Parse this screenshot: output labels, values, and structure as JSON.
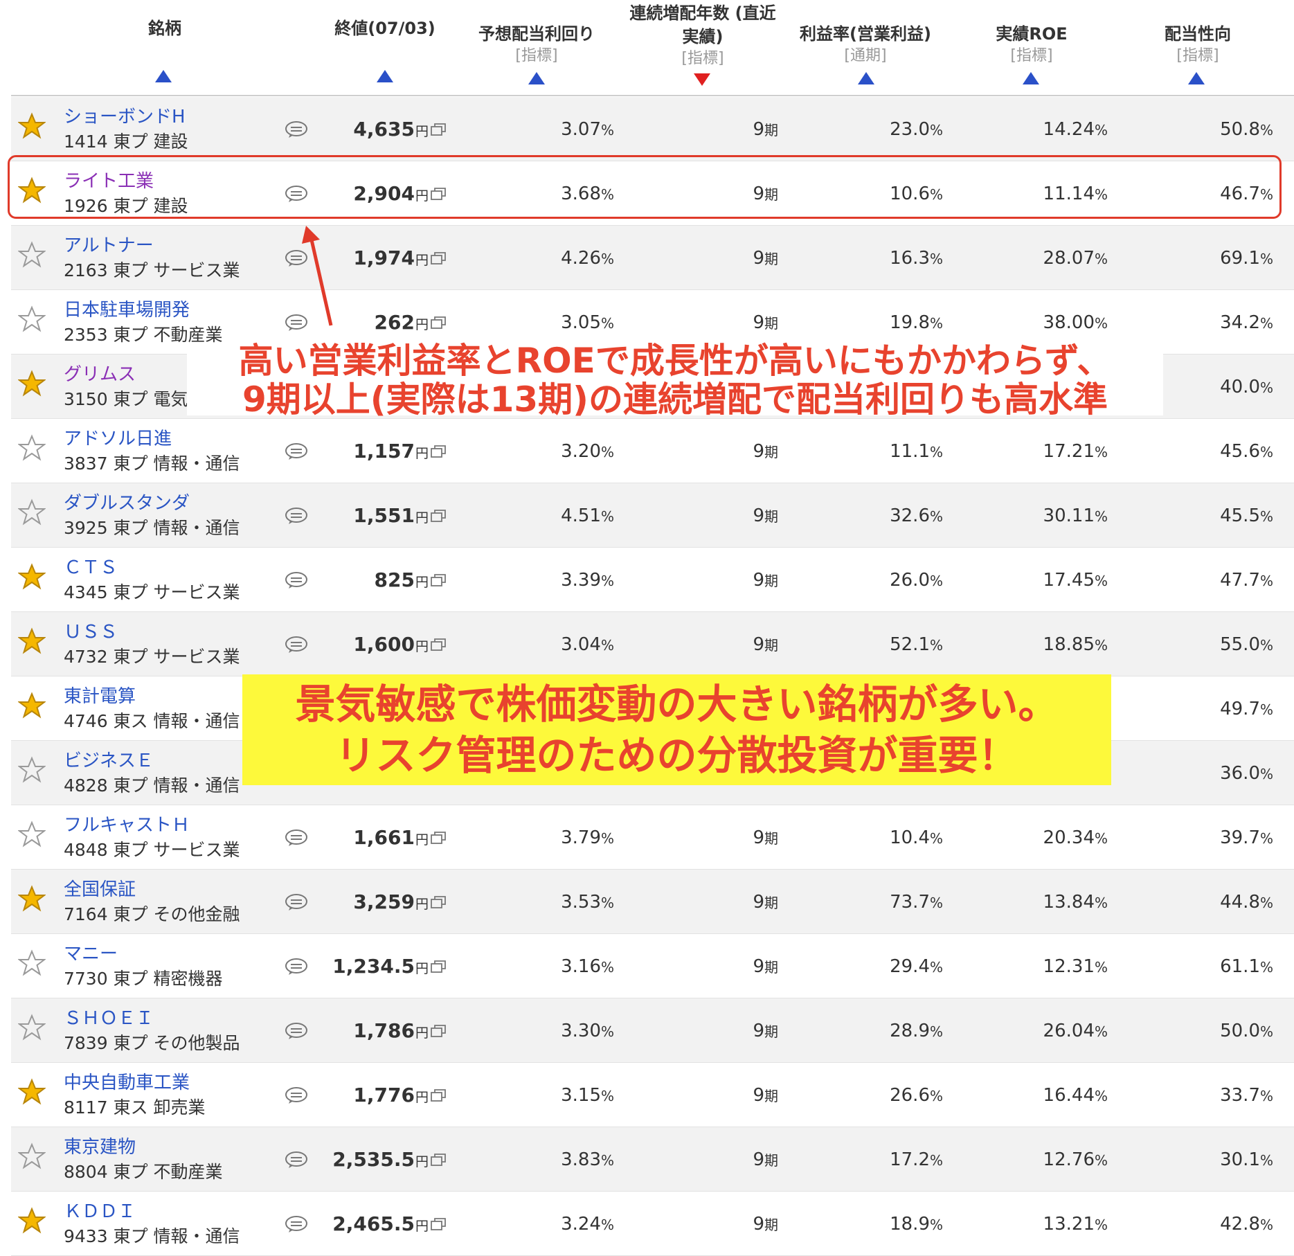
{
  "header": {
    "columns": [
      {
        "label": "銘柄",
        "sub": ""
      },
      {
        "label": "終値(07/03)",
        "sub": ""
      },
      {
        "label": "予想配当利回り",
        "sub": "[指標]"
      },
      {
        "label": "連続増配年数 (直近",
        "label2": "実績)",
        "sub": "[指標]"
      },
      {
        "label": "利益率(営業利益)",
        "sub": "[通期]"
      },
      {
        "label": "実績ROE",
        "sub": "[指標]"
      },
      {
        "label": "配当性向",
        "sub": "[指標]"
      }
    ],
    "sort_directions": [
      "asc",
      "asc",
      "asc",
      "desc",
      "asc",
      "asc",
      "asc"
    ]
  },
  "units": {
    "yen": "円",
    "pct": "%",
    "period": "期"
  },
  "colors": {
    "link_blue": "#2a55c4",
    "link_visited": "#8a2fb5",
    "star_gold": "#f5b700",
    "annotation_red": "#e8432e",
    "highlight_yellow": "#fdf93b",
    "sort_up": "#2a50c8",
    "sort_down": "#e02020"
  },
  "rows": [
    {
      "name": "ショーボンドH",
      "code": "1414",
      "market": "東プ",
      "sector": "建設",
      "favorite": true,
      "visited": false,
      "price": "4,635",
      "yield": "3.07",
      "periods": "9",
      "margin": "23.0",
      "roe": "14.24",
      "payout": "50.8"
    },
    {
      "name": "ライト工業",
      "code": "1926",
      "market": "東プ",
      "sector": "建設",
      "favorite": true,
      "visited": true,
      "price": "2,904",
      "yield": "3.68",
      "periods": "9",
      "margin": "10.6",
      "roe": "11.14",
      "payout": "46.7"
    },
    {
      "name": "アルトナー",
      "code": "2163",
      "market": "東プ",
      "sector": "サービス業",
      "favorite": false,
      "visited": false,
      "price": "1,974",
      "yield": "4.26",
      "periods": "9",
      "margin": "16.3",
      "roe": "28.07",
      "payout": "69.1"
    },
    {
      "name": "日本駐車場開発",
      "code": "2353",
      "market": "東プ",
      "sector": "不動産業",
      "favorite": false,
      "visited": false,
      "price": "262",
      "yield": "3.05",
      "periods": "9",
      "margin": "19.8",
      "roe": "38.00",
      "payout": "34.2"
    },
    {
      "name": "グリムス",
      "code": "3150",
      "market": "東プ",
      "sector": "電気",
      "favorite": true,
      "visited": true,
      "price": "",
      "yield": "",
      "periods": "",
      "margin": "",
      "roe": "",
      "payout": "40.0"
    },
    {
      "name": "アドソル日進",
      "code": "3837",
      "market": "東プ",
      "sector": "情報・通信",
      "favorite": false,
      "visited": false,
      "price": "1,157",
      "yield": "3.20",
      "periods": "9",
      "margin": "11.1",
      "roe": "17.21",
      "payout": "45.6"
    },
    {
      "name": "ダブルスタンダ",
      "code": "3925",
      "market": "東プ",
      "sector": "情報・通信",
      "favorite": false,
      "visited": false,
      "price": "1,551",
      "yield": "4.51",
      "periods": "9",
      "margin": "32.6",
      "roe": "30.11",
      "payout": "45.5"
    },
    {
      "name": "ＣＴＳ",
      "code": "4345",
      "market": "東プ",
      "sector": "サービス業",
      "favorite": true,
      "visited": false,
      "price": "825",
      "yield": "3.39",
      "periods": "9",
      "margin": "26.0",
      "roe": "17.45",
      "payout": "47.7"
    },
    {
      "name": "ＵＳＳ",
      "code": "4732",
      "market": "東プ",
      "sector": "サービス業",
      "favorite": true,
      "visited": false,
      "price": "1,600",
      "yield": "3.04",
      "periods": "9",
      "margin": "52.1",
      "roe": "18.85",
      "payout": "55.0"
    },
    {
      "name": "東計電算",
      "code": "4746",
      "market": "東ス",
      "sector": "情報・通信",
      "favorite": true,
      "visited": false,
      "price": "",
      "yield": "",
      "periods": "",
      "margin": "",
      "roe": "",
      "payout": "49.7"
    },
    {
      "name": "ビジネスＥ",
      "code": "4828",
      "market": "東プ",
      "sector": "情報・通信",
      "favorite": false,
      "visited": false,
      "price": "",
      "yield": "",
      "periods": "",
      "margin": "",
      "roe": "",
      "payout": "36.0"
    },
    {
      "name": "フルキャストＨ",
      "code": "4848",
      "market": "東プ",
      "sector": "サービス業",
      "favorite": false,
      "visited": false,
      "price": "1,661",
      "yield": "3.79",
      "periods": "9",
      "margin": "10.4",
      "roe": "20.34",
      "payout": "39.7"
    },
    {
      "name": "全国保証",
      "code": "7164",
      "market": "東プ",
      "sector": "その他金融",
      "favorite": true,
      "visited": false,
      "price": "3,259",
      "yield": "3.53",
      "periods": "9",
      "margin": "73.7",
      "roe": "13.84",
      "payout": "44.8"
    },
    {
      "name": "マニー",
      "code": "7730",
      "market": "東プ",
      "sector": "精密機器",
      "favorite": false,
      "visited": false,
      "price": "1,234.5",
      "yield": "3.16",
      "periods": "9",
      "margin": "29.4",
      "roe": "12.31",
      "payout": "61.1"
    },
    {
      "name": "ＳＨＯＥＩ",
      "code": "7839",
      "market": "東プ",
      "sector": "その他製品",
      "favorite": false,
      "visited": false,
      "price": "1,786",
      "yield": "3.30",
      "periods": "9",
      "margin": "28.9",
      "roe": "26.04",
      "payout": "50.0"
    },
    {
      "name": "中央自動車工業",
      "code": "8117",
      "market": "東ス",
      "sector": "卸売業",
      "favorite": true,
      "visited": false,
      "price": "1,776",
      "yield": "3.15",
      "periods": "9",
      "margin": "26.6",
      "roe": "16.44",
      "payout": "33.7"
    },
    {
      "name": "東京建物",
      "code": "8804",
      "market": "東プ",
      "sector": "不動産業",
      "favorite": false,
      "visited": false,
      "price": "2,535.5",
      "yield": "3.83",
      "periods": "9",
      "margin": "17.2",
      "roe": "12.76",
      "payout": "30.1"
    },
    {
      "name": "ＫＤＤＩ",
      "code": "9433",
      "market": "東プ",
      "sector": "情報・通信",
      "favorite": true,
      "visited": false,
      "price": "2,465.5",
      "yield": "3.24",
      "periods": "9",
      "margin": "18.9",
      "roe": "13.21",
      "payout": "42.8"
    }
  ],
  "annotations": {
    "note1_line1": "高い営業利益率とROEで成長性が高いにもかかわらず、",
    "note1_line2": "9期以上(実際は13期)の連続増配で配当利回りも高水準",
    "note2_line1": "景気敏感で株価変動の大きい銘柄が多い。",
    "note2_line2": "リスク管理のための分散投資が重要！"
  }
}
